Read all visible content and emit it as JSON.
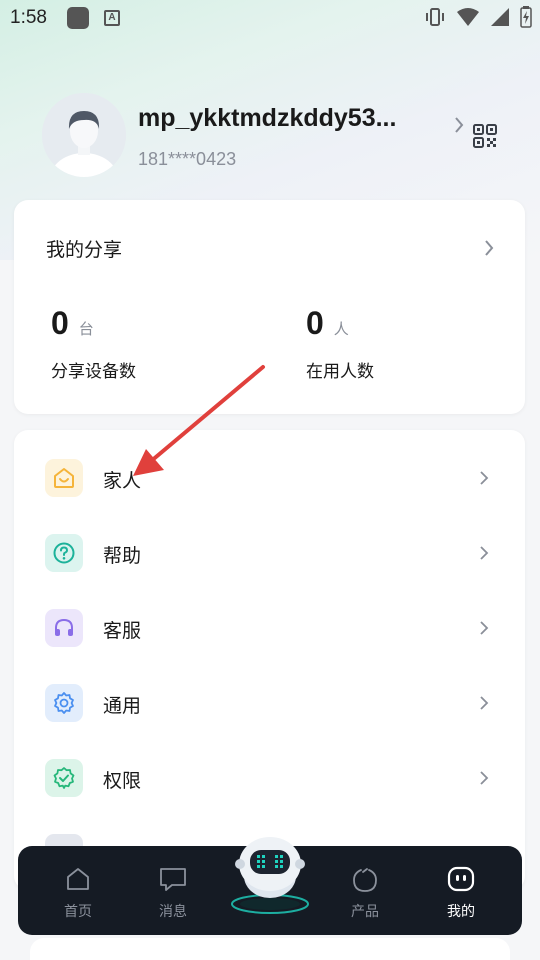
{
  "status_bar": {
    "time": "1:58",
    "app_badge_letter": "A"
  },
  "profile": {
    "username": "mp_ykktmdzkddy53...",
    "phone": "181****0423"
  },
  "share": {
    "title": "我的分享",
    "stats": [
      {
        "value": "0",
        "unit": "台",
        "label": "分享设备数"
      },
      {
        "value": "0",
        "unit": "人",
        "label": "在用人数"
      }
    ]
  },
  "menu": {
    "items": [
      {
        "label": "家人",
        "icon": "home-icon",
        "color": "#f5b43a",
        "bg": "#fdf3dc"
      },
      {
        "label": "帮助",
        "icon": "help-icon",
        "color": "#1cb29a",
        "bg": "#dcf4ef"
      },
      {
        "label": "客服",
        "icon": "headset-icon",
        "color": "#8a6de8",
        "bg": "#ece6fb"
      },
      {
        "label": "通用",
        "icon": "gear-icon",
        "color": "#4a8ff0",
        "bg": "#e2edfc"
      },
      {
        "label": "权限",
        "icon": "shield-check-icon",
        "color": "#26b77a",
        "bg": "#dcf4e9"
      }
    ]
  },
  "tabs": [
    {
      "label": "首页",
      "icon": "home-outline-icon",
      "active": false
    },
    {
      "label": "消息",
      "icon": "message-icon",
      "active": false
    },
    {
      "label": "",
      "icon": "robot-assistant-icon",
      "active": false
    },
    {
      "label": "产品",
      "icon": "product-ring-icon",
      "active": false
    },
    {
      "label": "我的",
      "icon": "profile-face-icon",
      "active": true
    }
  ],
  "colors": {
    "accent": "#1fd3c0",
    "annotation_arrow": "#e0403c",
    "tabbar_bg": "#151b24"
  }
}
